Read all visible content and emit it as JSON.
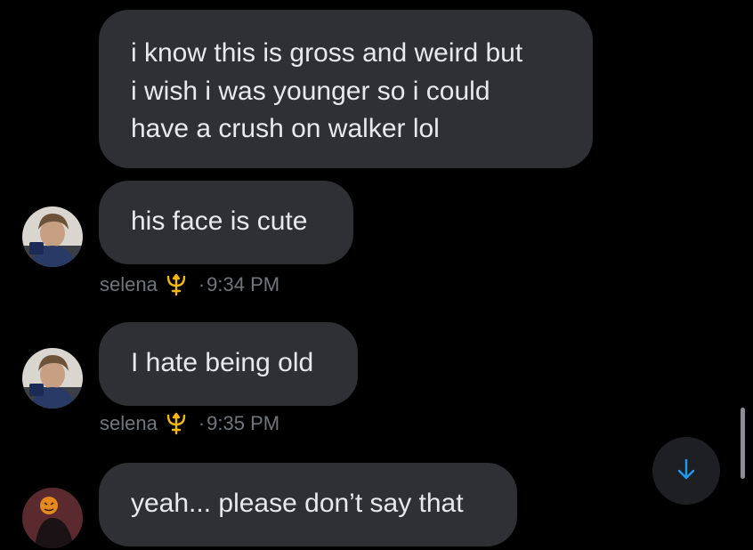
{
  "messages": [
    {
      "text": "i know this is gross and weird but\ni wish i was younger so i could\nhave a crush on walker lol"
    },
    {
      "text": "his face is cute",
      "sender": "selena",
      "time": "9:34 PM"
    },
    {
      "text": "I hate being old",
      "sender": "selena",
      "time": "9:35 PM"
    },
    {
      "text": "yeah... please don’t say that"
    }
  ],
  "meta_separator": "·",
  "icons": {
    "sender_badge": "trident-icon",
    "scroll_button": "arrow-down-icon"
  },
  "colors": {
    "background": "#000000",
    "bubble": "#2f3033",
    "text": "#e7e9ea",
    "meta_text": "#71767b",
    "accent": "#1d9bf0",
    "trident": "#f5b90a"
  }
}
